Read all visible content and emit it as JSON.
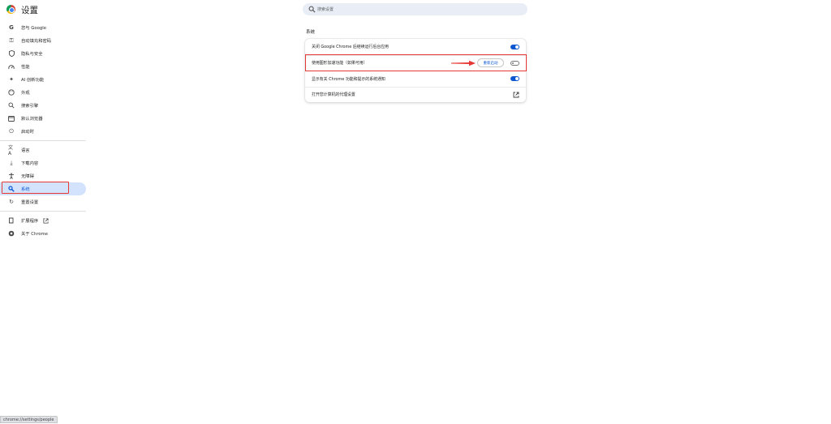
{
  "header": {
    "title": "设置"
  },
  "search": {
    "placeholder": "搜索设置"
  },
  "sidebar": {
    "items": [
      {
        "label": "您与 Google",
        "icon": "google-icon"
      },
      {
        "label": "自动填充和密码",
        "icon": "key-icon"
      },
      {
        "label": "隐私与安全",
        "icon": "shield-icon"
      },
      {
        "label": "性能",
        "icon": "speedometer-icon"
      },
      {
        "label": "AI 创新功能",
        "icon": "sparkle-icon"
      },
      {
        "label": "外观",
        "icon": "palette-icon"
      },
      {
        "label": "搜索引擎",
        "icon": "search-icon"
      },
      {
        "label": "默认浏览器",
        "icon": "browser-icon"
      },
      {
        "label": "启动时",
        "icon": "power-icon"
      },
      {
        "label": "语言",
        "icon": "translate-icon"
      },
      {
        "label": "下载内容",
        "icon": "download-icon"
      },
      {
        "label": "无障碍",
        "icon": "accessibility-icon"
      },
      {
        "label": "系统",
        "icon": "wrench-icon",
        "active": true
      },
      {
        "label": "重置设置",
        "icon": "reset-icon"
      },
      {
        "label": "扩展程序",
        "icon": "puzzle-icon"
      },
      {
        "label": "关于 Chrome",
        "icon": "chrome-icon"
      }
    ]
  },
  "main": {
    "section_title": "系统",
    "rows": [
      {
        "label": "关闭 Google Chrome 后继续运行后台应用",
        "control": "toggle",
        "state": "on"
      },
      {
        "label": "使用图形加速功能（如果可用）",
        "control": "toggle",
        "state": "off",
        "button_label": "重新启动"
      },
      {
        "label": "显示有关 Chrome 功能和提示的系统通知",
        "control": "toggle",
        "state": "on"
      },
      {
        "label": "打开您计算机的代理设置",
        "control": "external-link"
      }
    ]
  },
  "statusbar": {
    "url": "chrome://settings/people"
  },
  "colors": {
    "accent": "#0b57d0",
    "active_bg": "#d3e3fd",
    "highlight": "#e53935"
  }
}
